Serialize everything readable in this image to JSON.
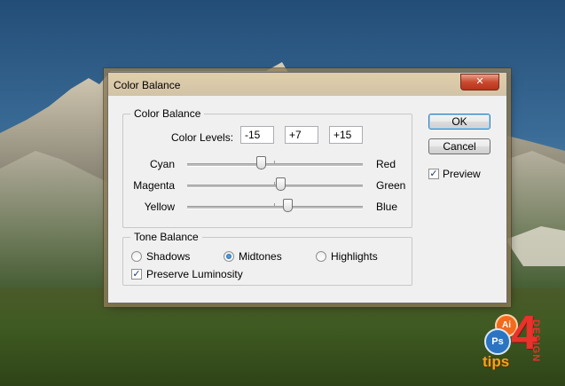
{
  "dialog": {
    "title": "Color Balance",
    "close_icon": "close-icon"
  },
  "color_balance": {
    "legend": "Color Balance",
    "levels_label": "Color Levels:",
    "levels": [
      "-15",
      "+7",
      "+15"
    ],
    "sliders": [
      {
        "left": "Cyan",
        "right": "Red",
        "value": -15
      },
      {
        "left": "Magenta",
        "right": "Green",
        "value": 7
      },
      {
        "left": "Yellow",
        "right": "Blue",
        "value": 15
      }
    ]
  },
  "tone_balance": {
    "legend": "Tone Balance",
    "options": [
      "Shadows",
      "Midtones",
      "Highlights"
    ],
    "selected": "Midtones",
    "preserve_label": "Preserve Luminosity",
    "preserve_checked": true
  },
  "buttons": {
    "ok": "OK",
    "cancel": "Cancel",
    "preview_label": "Preview",
    "preview_checked": true
  },
  "logo": {
    "ps": "Ps",
    "ai": "Ai",
    "four": "4",
    "tips": "tips",
    "design": "DESIGN"
  }
}
